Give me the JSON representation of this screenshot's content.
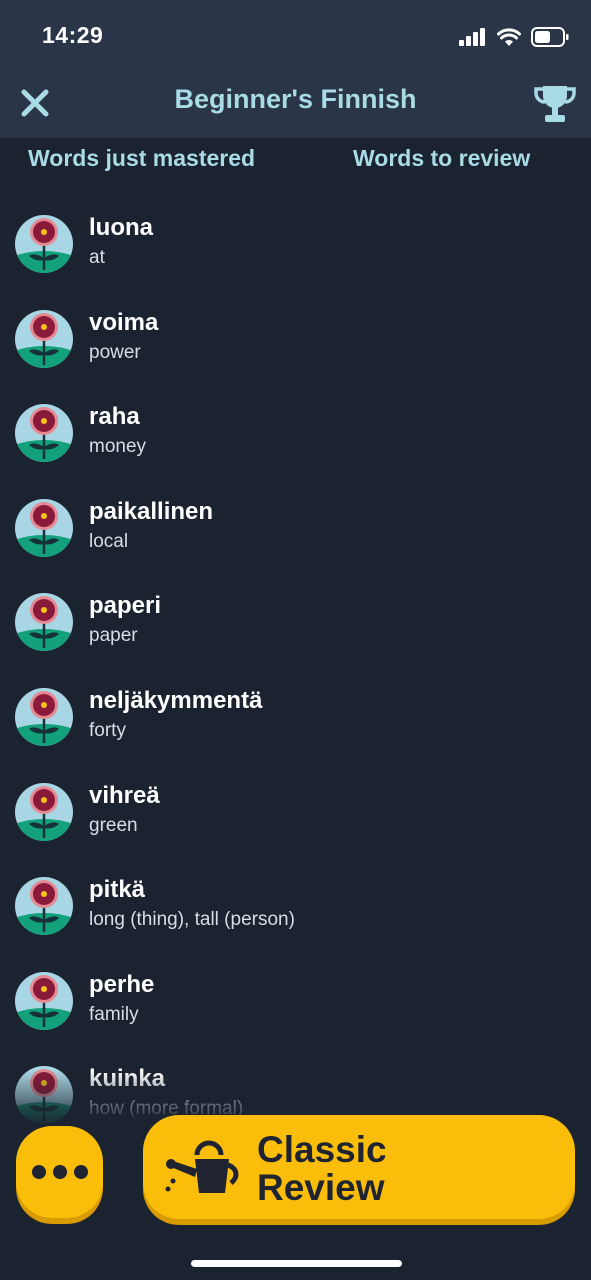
{
  "status_bar": {
    "time": "14:29"
  },
  "header": {
    "title": "Beginner's Finnish"
  },
  "columns": {
    "left": "Words just mastered",
    "right": "Words to review"
  },
  "words": [
    {
      "term": "luona",
      "definition": "at"
    },
    {
      "term": "voima",
      "definition": "power"
    },
    {
      "term": "raha",
      "definition": "money"
    },
    {
      "term": "paikallinen",
      "definition": "local"
    },
    {
      "term": "paperi",
      "definition": "paper"
    },
    {
      "term": "neljäkymmentä",
      "definition": "forty"
    },
    {
      "term": "vihreä",
      "definition": "green"
    },
    {
      "term": "pitkä",
      "definition": "long (thing), tall (person)"
    },
    {
      "term": "perhe",
      "definition": "family"
    },
    {
      "term": "kuinka",
      "definition": "how (more formal)"
    }
  ],
  "buttons": {
    "review_label": "Classic Review"
  },
  "colors": {
    "accent": "#f9bd0a",
    "heading": "#a8dbe6",
    "background": "#1c2330",
    "header_bg": "#2a3547"
  },
  "icons": {
    "close": "close-icon",
    "trophy": "trophy-icon",
    "more": "more-dots-icon",
    "watering_can": "watering-can-icon",
    "flower": "flower-icon"
  }
}
